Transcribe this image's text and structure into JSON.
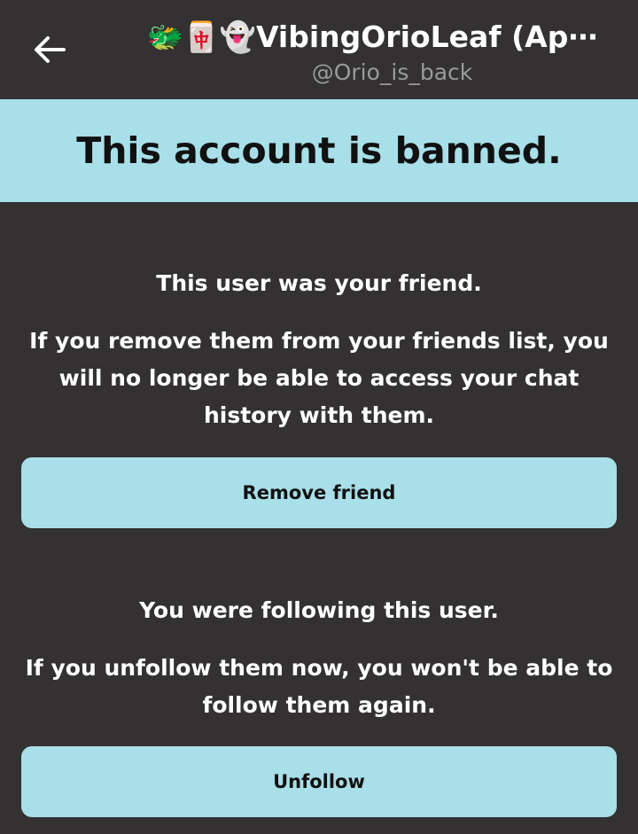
{
  "header": {
    "back_icon": "arrow-left-icon",
    "title_emoji": "🐲🀄👻",
    "title": "VibingOrioLeaf (Ap⋯",
    "handle": "@Orio_is_back"
  },
  "banner": {
    "text": "This account is banned."
  },
  "friend_section": {
    "heading": "This user was your friend.",
    "body": "If you remove them from your friends list, you will no longer be able to access your chat history with them.",
    "button_label": "Remove friend"
  },
  "follow_section": {
    "heading": "You were following this user.",
    "body": "If you unfollow them now, you won't be able to follow them again.",
    "button_label": "Unfollow"
  },
  "colors": {
    "background": "#333132",
    "accent": "#a8dfe8",
    "handle_text": "#9b9a9b"
  }
}
